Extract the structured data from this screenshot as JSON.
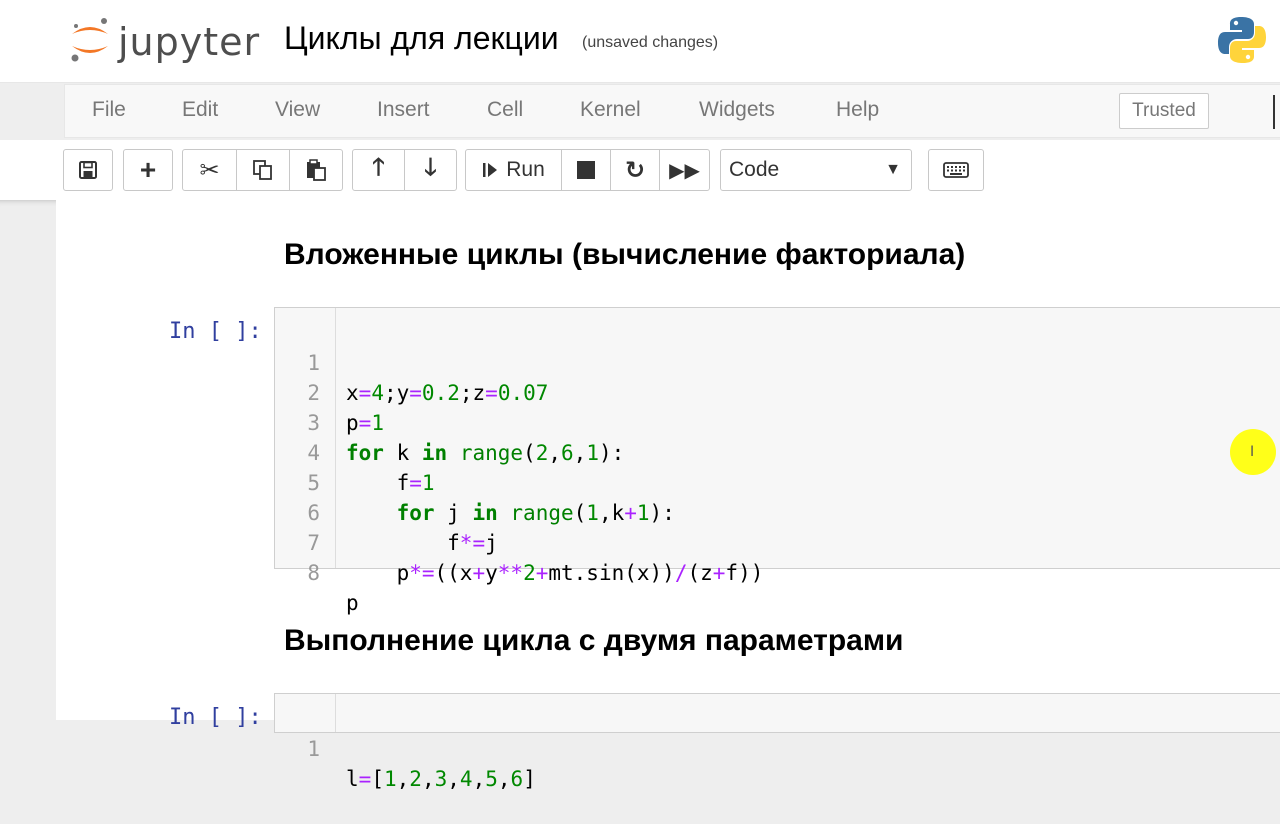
{
  "header": {
    "logo_text": "jupyter",
    "notebook_name": "Циклы для лекции",
    "save_status": "(unsaved changes)"
  },
  "menubar": {
    "items": [
      "File",
      "Edit",
      "View",
      "Insert",
      "Cell",
      "Kernel",
      "Widgets",
      "Help"
    ],
    "trusted_label": "Trusted"
  },
  "toolbar": {
    "run_label": "Run",
    "cell_type_selected": "Code",
    "icons": [
      "save-icon",
      "add-cell-icon",
      "cut-icon",
      "copy-icon",
      "paste-icon",
      "move-up-icon",
      "move-down-icon",
      "run-icon",
      "stop-icon",
      "restart-icon",
      "fast-forward-icon",
      "keyboard-icon"
    ]
  },
  "notebook": {
    "heading1": "Вложенные циклы (вычисление факториала)",
    "cell1": {
      "prompt": "In [ ]:",
      "lines": [
        {
          "n": "1",
          "code": "x=4;y=0.2;z=0.07"
        },
        {
          "n": "2",
          "code": "p=1"
        },
        {
          "n": "3",
          "code": "for k in range(2,6,1):"
        },
        {
          "n": "4",
          "code": "    f=1"
        },
        {
          "n": "5",
          "code": "    for j in range(1,k+1):"
        },
        {
          "n": "6",
          "code": "        f*=j"
        },
        {
          "n": "7",
          "code": "    p*=((x+y**2+mt.sin(x))/(z+f))"
        },
        {
          "n": "8",
          "code": "p"
        }
      ]
    },
    "heading2": "Выполнение цикла с двумя параметрами",
    "cell2": {
      "prompt": "In [ ]:",
      "lines": [
        {
          "n": "1",
          "code": "l=[1,2,3,4,5,6]"
        }
      ]
    }
  },
  "colors": {
    "keyword": "#008000",
    "operator": "#aa22ff",
    "number": "#008800",
    "prompt": "#303f9f",
    "cursor_highlight": "#ffff00"
  },
  "cursor_icon": "text-cursor-icon"
}
